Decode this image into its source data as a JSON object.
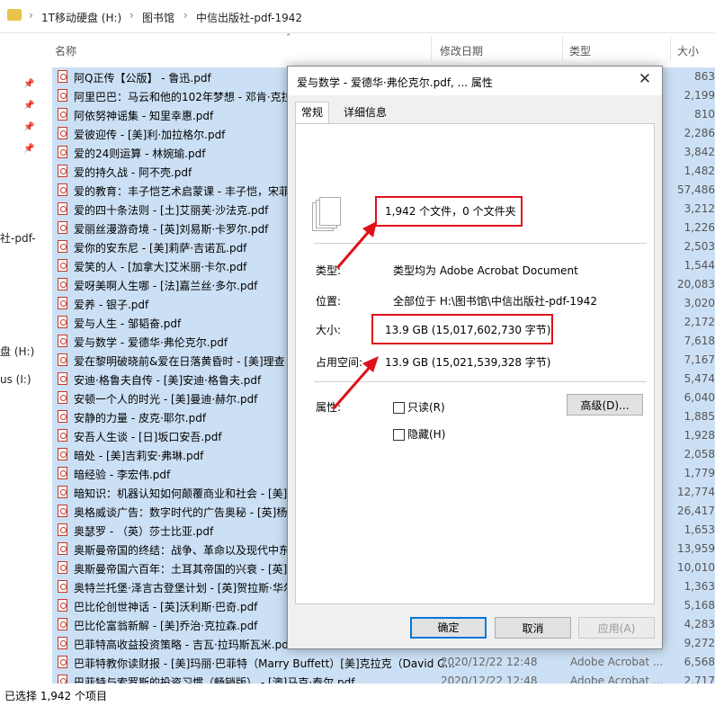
{
  "address": {
    "crumbs": [
      "1T移动硬盘 (H:)",
      "图书馆",
      "中信出版社-pdf-1942"
    ],
    "separator": "›"
  },
  "columns": {
    "name": "名称",
    "date": "修改日期",
    "type": "类型",
    "size": "大小"
  },
  "nav": {
    "item1": "社-pdf-",
    "item2": "盘 (H:)",
    "item3": "us (I:)"
  },
  "files": [
    {
      "name": "阿Q正传【公版】 - 鲁迅.pdf",
      "size": "863"
    },
    {
      "name": "阿里巴巴：马云和他的102年梦想 - 邓肯·克拉",
      "size": "2,199"
    },
    {
      "name": "阿依努神谣集 - 知里幸惠.pdf",
      "size": "810"
    },
    {
      "name": "爱彼迎传 - [美]利·加拉格尔.pdf",
      "size": "2,286"
    },
    {
      "name": "爱的24则运算 - 林婉瑜.pdf",
      "size": "3,842"
    },
    {
      "name": "爱的持久战 - 阿不壳.pdf",
      "size": "1,482"
    },
    {
      "name": "爱的教育：丰子恺艺术启蒙课 - 丰子恺，宋菲",
      "size": "57,486"
    },
    {
      "name": "爱的四十条法则 - [土]艾丽芙·沙法克.pdf",
      "size": "3,212"
    },
    {
      "name": "爱丽丝漫游奇境 - [英]刘易斯·卡罗尔.pdf",
      "size": "1,226"
    },
    {
      "name": "爱你的安东尼 - [美]莉萨·吉诺瓦.pdf",
      "size": "2,503"
    },
    {
      "name": "爱笑的人 - [加拿大]艾米丽·卡尔.pdf",
      "size": "1,544"
    },
    {
      "name": "爱呀美啊人生哪 - [法]嘉兰丝·多尔.pdf",
      "size": "20,083"
    },
    {
      "name": "爱养 - 银子.pdf",
      "size": "3,020"
    },
    {
      "name": "爱与人生 - 邹韬奋.pdf",
      "size": "2,172"
    },
    {
      "name": "爱与数学 - 爱德华·弗伦克尔.pdf",
      "size": "7,618"
    },
    {
      "name": "爱在黎明破晓前&爱在日落黄昏时 - [美]理查",
      "size": "7,167"
    },
    {
      "name": "安迪·格鲁夫自传 - [美]安迪·格鲁夫.pdf",
      "size": "5,474"
    },
    {
      "name": "安顿一个人的时光 - [美]曼迪·赫尔.pdf",
      "size": "6,040"
    },
    {
      "name": "安静的力量 - 皮克·耶尔.pdf",
      "size": "1,885"
    },
    {
      "name": "安吾人生谈 - [日]坂口安吾.pdf",
      "size": "1,928"
    },
    {
      "name": "暗处 - [美]吉莉安·弗琳.pdf",
      "size": "2,058"
    },
    {
      "name": "暗经验 - 李宏伟.pdf",
      "size": "1,779"
    },
    {
      "name": "暗知识：机器认知如何颠覆商业和社会 - [美]",
      "size": "12,774"
    },
    {
      "name": "奥格威谈广告：数字时代的广告奥秘 - [英]杨",
      "size": "26,417"
    },
    {
      "name": "奥瑟罗 - （英）莎士比亚.pdf",
      "size": "1,653"
    },
    {
      "name": "奥斯曼帝国的终结：战争、革命以及现代中东",
      "size": "13,959"
    },
    {
      "name": "奥斯曼帝国六百年：土耳其帝国的兴衰 - [英]",
      "size": "10,010"
    },
    {
      "name": "奥特兰托堡·泽言古登堡计划 - [英]贺拉斯·华尔",
      "size": "1,363"
    },
    {
      "name": "巴比伦创世神话 - [英]沃利斯·巴奇.pdf",
      "size": "5,168"
    },
    {
      "name": "巴比伦富翁新解 - [美]乔治·克拉森.pdf",
      "size": "4,283"
    },
    {
      "name": "巴菲特高收益投资策略 - 吉瓦·拉玛斯瓦米.pdf",
      "size": "9,272"
    },
    {
      "name": "巴菲特教你读财报 - [美]玛丽·巴菲特（Marry Buffett）[美]克拉克（David C...",
      "date": "2020/12/22 12:48",
      "type": "Adobe Acrobat ...",
      "size": "6,568"
    },
    {
      "name": "巴菲特与索罗斯的投资习惯（畅销版） - [澳]马克·泰尔.pdf",
      "date": "2020/12/22 12:48",
      "type": "Adobe Acrobat ...",
      "size": "2,717"
    }
  ],
  "status": "已选择 1,942 个项目",
  "dialog": {
    "title": "爱与数学 - 爱德华·弗伦克尔.pdf, ... 属性",
    "close": "✕",
    "tab_general": "常规",
    "tab_details": "详细信息",
    "summary": "1,942 个文件，0 个文件夹",
    "type_label": "类型:",
    "type_value": "类型均为 Adobe Acrobat Document",
    "location_label": "位置:",
    "location_value": "全部位于 H:\\图书馆\\中信出版社-pdf-1942",
    "size_label": "大小:",
    "size_value": "13.9 GB (15,017,602,730 字节)",
    "disk_label": "占用空间:",
    "disk_value": "13.9 GB (15,021,539,328 字节)",
    "attr_label": "属性:",
    "readonly": "只读(R)",
    "hidden": "隐藏(H)",
    "advanced": "高级(D)...",
    "ok": "确定",
    "cancel": "取消",
    "apply": "应用(A)"
  },
  "colors": {
    "selection": "#cce0f5",
    "highlight_box": "#e0101a",
    "folder": "#e8c44a",
    "pdf_icon": "#c0392b"
  },
  "icons": [
    "folder-icon",
    "pdf-file-icon",
    "pin-icon",
    "multi-file-icon",
    "close-icon",
    "sort-up-icon",
    "red-arrow-icon"
  ]
}
